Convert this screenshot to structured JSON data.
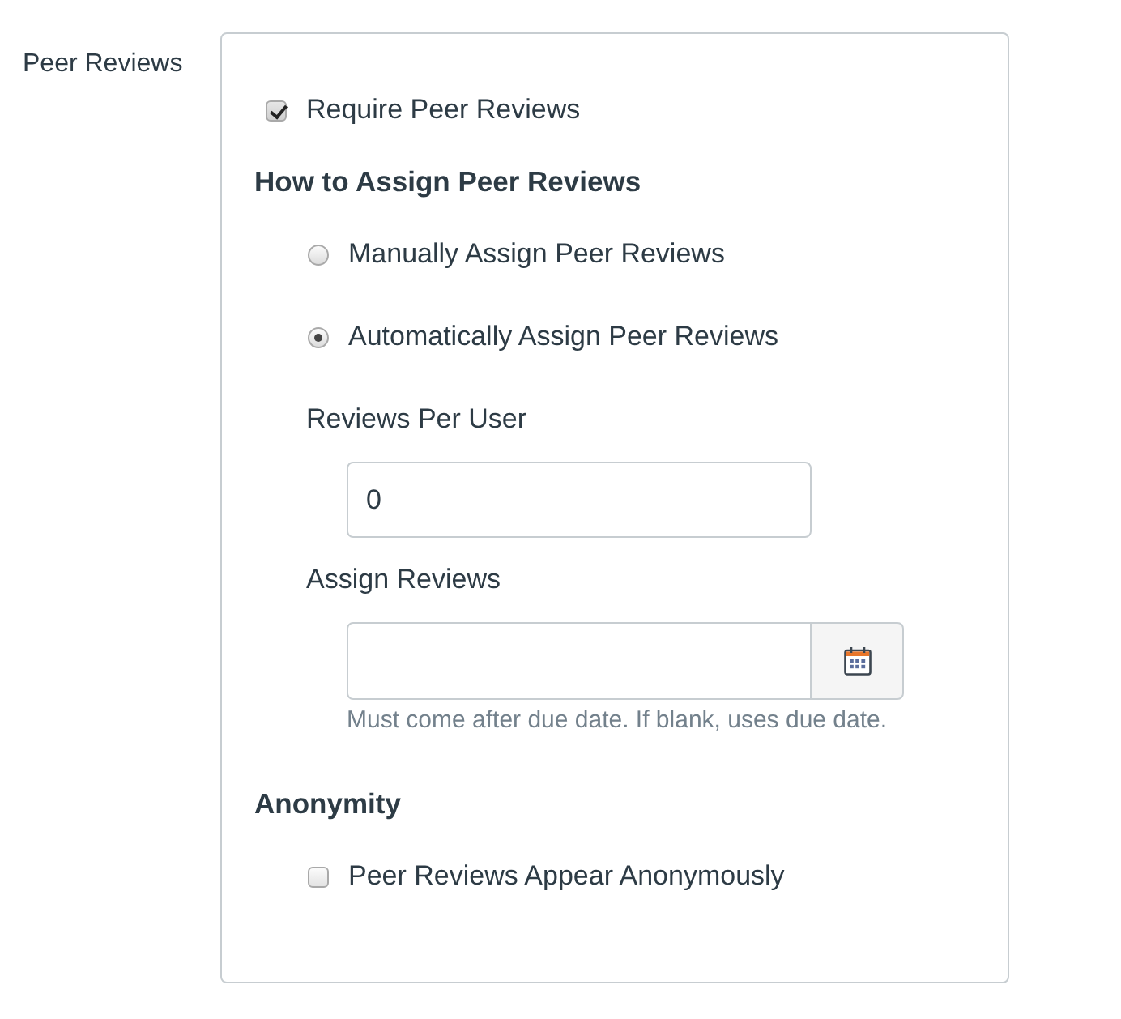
{
  "field_label": "Peer Reviews",
  "require_checkbox": {
    "label": "Require Peer Reviews",
    "checked": true
  },
  "assign_section": {
    "heading": "How to Assign Peer Reviews",
    "options": [
      {
        "label": "Manually Assign Peer Reviews",
        "selected": false
      },
      {
        "label": "Automatically Assign Peer Reviews",
        "selected": true
      }
    ],
    "reviews_per_user": {
      "label": "Reviews Per User",
      "value": "0"
    },
    "assign_reviews": {
      "label": "Assign Reviews",
      "hint": "Must come after due date. If blank, uses due date."
    }
  },
  "anonymity_section": {
    "heading": "Anonymity",
    "checkbox": {
      "label": "Peer Reviews Appear Anonymously",
      "checked": false
    }
  }
}
